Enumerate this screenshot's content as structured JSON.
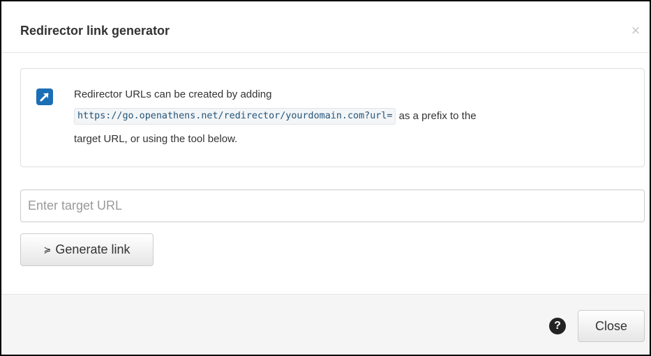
{
  "dialog": {
    "title": "Redirector link generator",
    "close_glyph": "×",
    "close_icon": "close-icon"
  },
  "info": {
    "icon": "external-link-icon",
    "accent_color": "#1b6fb5",
    "line1": "Redirector URLs can be created by adding",
    "prefix_url": "https://go.openathens.net/redirector/yourdomain.com?url=",
    "line2_suffix": "as a prefix to the",
    "line3": "target URL, or using the tool below."
  },
  "form": {
    "target_url_value": "",
    "target_url_placeholder": "Enter target URL",
    "generate_icon": "double-chevron-down-icon",
    "generate_glyph": "≽",
    "generate_label": "Generate link"
  },
  "footer": {
    "help_icon": "question-circle-icon",
    "help_glyph": "?",
    "close_label": "Close"
  }
}
